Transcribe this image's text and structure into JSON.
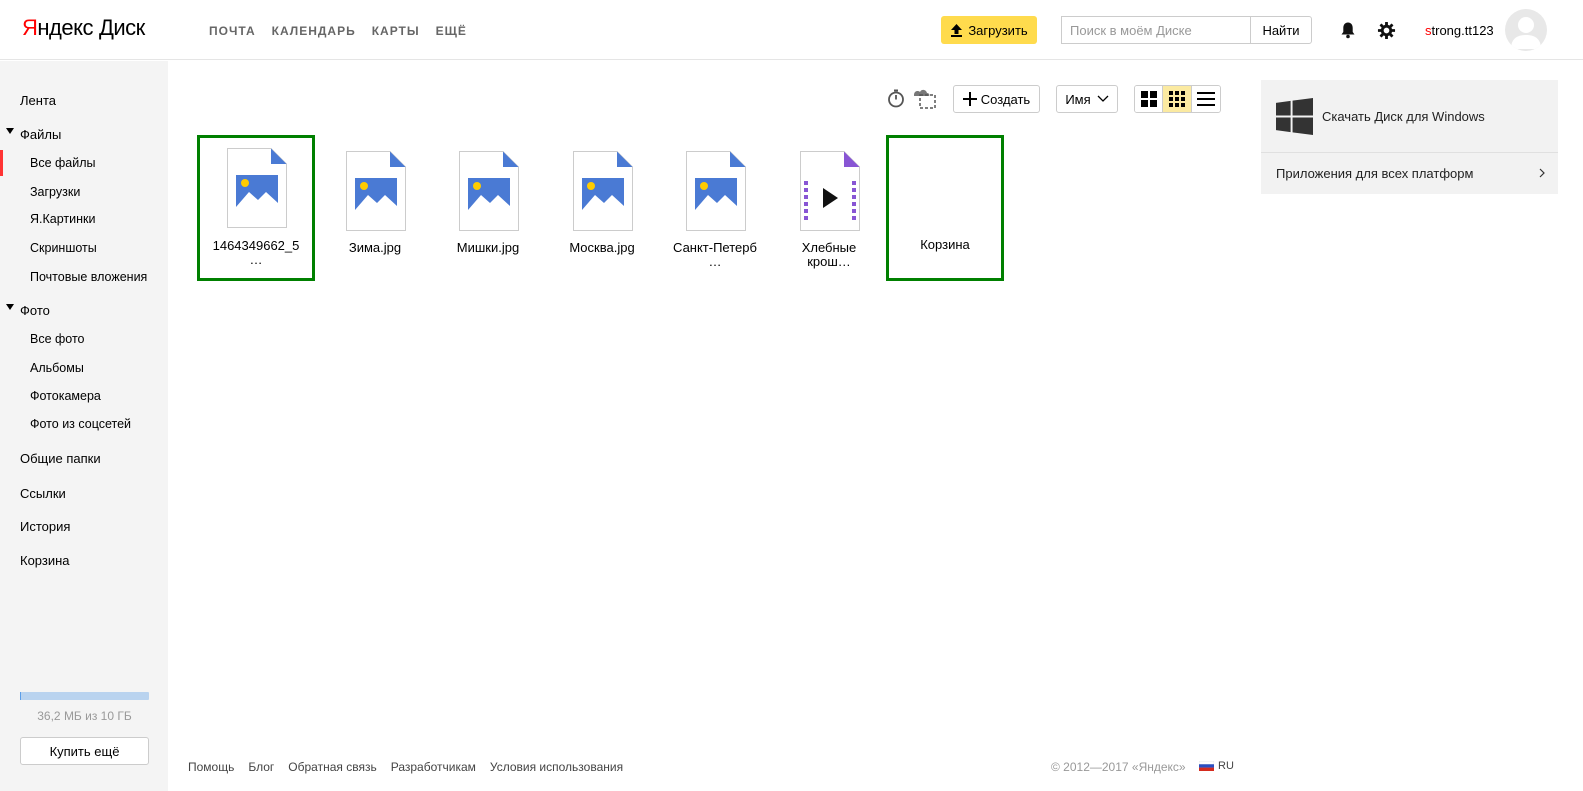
{
  "logo": {
    "ya": "Я",
    "rest": "ндекс",
    "product": "Диск"
  },
  "topnav": [
    "ПОЧТА",
    "КАЛЕНДАРЬ",
    "КАРТЫ",
    "ЕЩЁ"
  ],
  "upload_label": "Загрузить",
  "search": {
    "placeholder": "Поиск в моём Диске",
    "value": "",
    "button": "Найти"
  },
  "user": {
    "first_letter": "s",
    "rest": "trong.tt123"
  },
  "sidebar": {
    "feed": "Лента",
    "files": "Файлы",
    "files_items": [
      "Все файлы",
      "Загрузки",
      "Я.Картинки",
      "Скриншоты",
      "Почтовые вложения"
    ],
    "photo": "Фото",
    "photo_items": [
      "Все фото",
      "Альбомы",
      "Фотокамера",
      "Фото из соцсетей"
    ],
    "shared": "Общие папки",
    "links": "Ссылки",
    "history": "История",
    "trash": "Корзина"
  },
  "quota": {
    "text": "36,2 МБ из 10 ГБ",
    "used_fraction": 0.0035
  },
  "buy_label": "Купить ещё",
  "toolbar": {
    "create": "Создать",
    "sort": "Имя"
  },
  "files": [
    {
      "name": "1464349662_5\n…",
      "type": "image",
      "selected": true
    },
    {
      "name": "Зима.jpg",
      "type": "image",
      "selected": false
    },
    {
      "name": "Мишки.jpg",
      "type": "image",
      "selected": false
    },
    {
      "name": "Москва.jpg",
      "type": "image",
      "selected": false
    },
    {
      "name": "Санкт-Петерб\n…",
      "type": "image",
      "selected": false
    },
    {
      "name": "Хлебные\nкрош…",
      "type": "video",
      "selected": false
    },
    {
      "name": "Корзина",
      "type": "trash",
      "selected": true
    }
  ],
  "promo": {
    "windows": "Скачать Диск для Windows",
    "apps": "Приложения для всех платформ"
  },
  "footer": {
    "links": [
      "Помощь",
      "Блог",
      "Обратная связь",
      "Разработчикам",
      "Условия использования"
    ],
    "copyright": "© 2012—2017 «Яндекс»",
    "lang": "RU"
  },
  "colors": {
    "accent": "#ffdb4d",
    "selection": "#008000",
    "file_icon": "#4a7ad4",
    "video_icon": "#8855d4"
  }
}
